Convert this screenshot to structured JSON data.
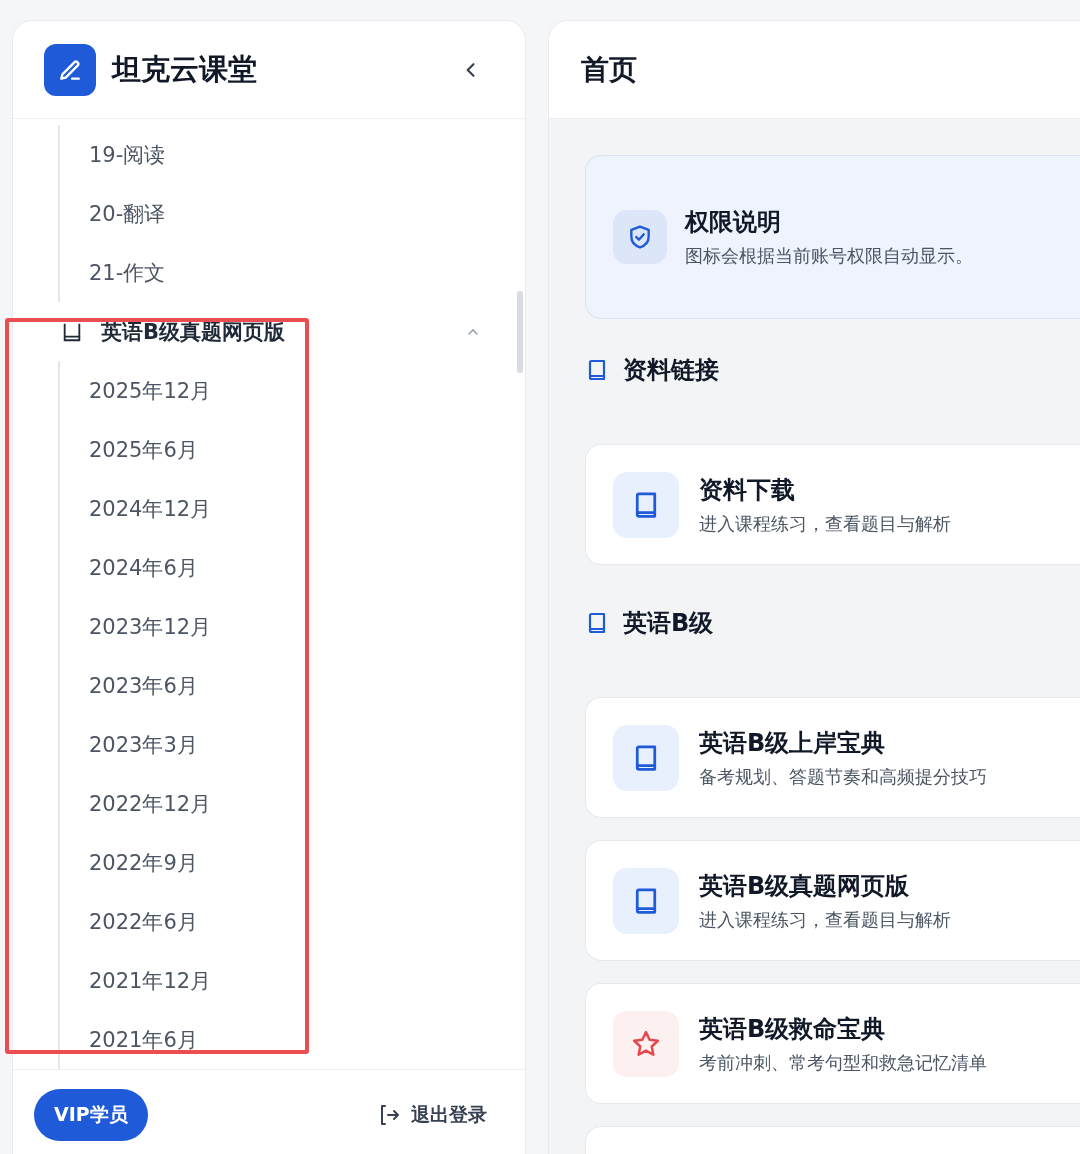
{
  "sidebar": {
    "brand": "坦克云课堂",
    "nav": [
      {
        "kind": "tail",
        "children": [
          {
            "label": "19-阅读"
          },
          {
            "label": "20-翻译"
          },
          {
            "label": "21-作文"
          }
        ]
      },
      {
        "kind": "group",
        "label": "英语B级真题网页版",
        "expanded": true,
        "children": [
          {
            "label": "2025年12月"
          },
          {
            "label": "2025年6月"
          },
          {
            "label": "2024年12月"
          },
          {
            "label": "2024年6月"
          },
          {
            "label": "2023年12月"
          },
          {
            "label": "2023年6月"
          },
          {
            "label": "2023年3月"
          },
          {
            "label": "2022年12月"
          },
          {
            "label": "2022年9月"
          },
          {
            "label": "2022年6月"
          },
          {
            "label": "2021年12月"
          },
          {
            "label": "2021年6月"
          }
        ]
      }
    ],
    "badge": "VIP学员",
    "logout": "退出登录"
  },
  "main": {
    "title": "首页",
    "blocks": [
      {
        "kind": "notice",
        "title": "权限说明",
        "text": "图标会根据当前账号权限自动显示。"
      },
      {
        "kind": "heading",
        "text": "资料链接"
      },
      {
        "kind": "card",
        "title": "资料下载",
        "text": "进入课程练习，查看题目与解析"
      },
      {
        "kind": "heading",
        "text": "英语B级"
      },
      {
        "kind": "card",
        "title": "英语B级上岸宝典",
        "text": "备考规划、答题节奏和高频提分技巧"
      },
      {
        "kind": "card",
        "title": "英语B级真题网页版",
        "text": "进入课程练习，查看题目与解析"
      },
      {
        "kind": "starred-card",
        "title": "英语B级救命宝典",
        "text": "考前冲刺、常考句型和救急记忆清单"
      },
      {
        "kind": "card-cut"
      }
    ]
  },
  "annotation": {
    "kind": "rectangle"
  }
}
